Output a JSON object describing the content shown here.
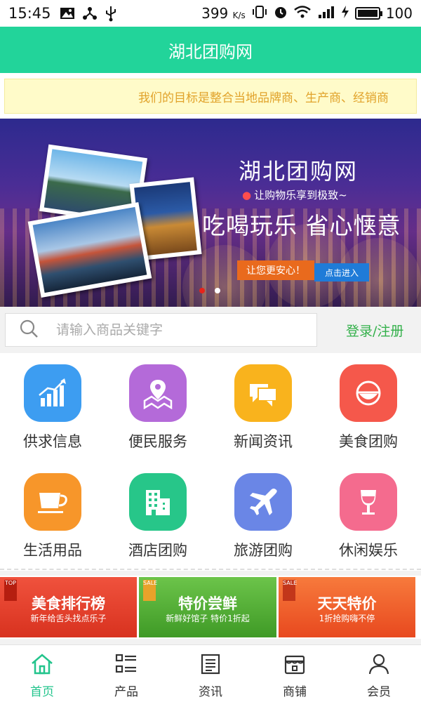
{
  "status_bar": {
    "time": "15:45",
    "net_speed": "399",
    "net_unit": "K/s",
    "battery": "100",
    "icons": [
      "image-icon",
      "share-icon",
      "usb-icon",
      "vibrate-icon",
      "alarm-icon",
      "wifi-icon",
      "signal-icon",
      "charging-icon",
      "battery-icon"
    ]
  },
  "header": {
    "title": "湖北团购网"
  },
  "notice": {
    "text": "我们的目标是整合当地品牌商、生产商、经销商"
  },
  "banner": {
    "title": "湖北团购网",
    "subtitle": "让购物乐享到极致~",
    "slogan": "吃喝玩乐 省心惬意",
    "cta_left": "让您更安心！",
    "cta_right": "点击进入"
  },
  "search": {
    "placeholder": "请输入商品关键字",
    "login_label": "登录/注册"
  },
  "categories": [
    {
      "label": "供求信息",
      "icon": "chart-icon",
      "color": "#3d9df1"
    },
    {
      "label": "便民服务",
      "icon": "map-pin-icon",
      "color": "#b46ad9"
    },
    {
      "label": "新闻资讯",
      "icon": "chat-icon",
      "color": "#f9b31d"
    },
    {
      "label": "美食团购",
      "icon": "bowl-icon",
      "color": "#f5584b"
    },
    {
      "label": "生活用品",
      "icon": "cup-icon",
      "color": "#f7962a"
    },
    {
      "label": "酒店团购",
      "icon": "building-icon",
      "color": "#27c689"
    },
    {
      "label": "旅游团购",
      "icon": "plane-icon",
      "color": "#6a86e6"
    },
    {
      "label": "休闲娱乐",
      "icon": "wine-icon",
      "color": "#f46b8e"
    }
  ],
  "promos": [
    {
      "title": "美食排行榜",
      "subtitle": "新年给舌头找点乐子",
      "tag": "TOP",
      "color": "#e53d2a"
    },
    {
      "title": "特价尝鲜",
      "subtitle": "新鲜好馆子 特价1折起",
      "tag": "SALE",
      "color": "#4fae2f"
    },
    {
      "title": "天天特价",
      "subtitle": "1折抢购嗨不停",
      "tag": "SALE",
      "color": "#f0612d"
    }
  ],
  "bottom_nav": [
    {
      "label": "首页",
      "icon": "home-icon",
      "active": true
    },
    {
      "label": "产品",
      "icon": "grid-list-icon",
      "active": false
    },
    {
      "label": "资讯",
      "icon": "news-icon",
      "active": false
    },
    {
      "label": "商铺",
      "icon": "shop-icon",
      "active": false
    },
    {
      "label": "会员",
      "icon": "user-icon",
      "active": false
    }
  ],
  "colors": {
    "accent": "#22d49a",
    "login": "#33b04a",
    "notice_text": "#e1a32b"
  }
}
